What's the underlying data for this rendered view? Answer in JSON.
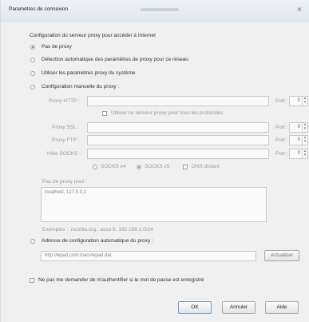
{
  "window": {
    "title": "Paramètres de connexion"
  },
  "section_heading": "Configuration du serveur proxy pour accéder à Internet",
  "proxy_options": {
    "no_proxy": "Pas de proxy",
    "auto_detect": "Détection automatique des paramètres de proxy pour ce réseau",
    "system": "Utiliser les paramètres proxy du système",
    "manual": "Configuration manuelle du proxy :",
    "auto_url": "Adresse de configuration automatique du proxy :"
  },
  "manual": {
    "http_label": "Proxy HTTP :",
    "use_for_all": "Utiliser ce serveur proxy pour tous les protocoles",
    "ssl_label": "Proxy SSL :",
    "ftp_label": "Proxy FTP :",
    "socks_label": "Hôte SOCKS :",
    "port_label": "Port :",
    "port_value": "0",
    "socks_v4": "SOCKS v4",
    "socks_v5": "SOCKS v5",
    "remote_dns": "DNS distant"
  },
  "no_proxy_for": {
    "label": "Pas de proxy pour :",
    "value": "localhost, 127.0.0.1",
    "example": "Exemples : .mozilla.org, .asso.fr, 192.168.1.0/24"
  },
  "auto_config": {
    "url": "http://wpad.cdm.mars/wpad.dat",
    "reload_label": "Actualiser"
  },
  "dont_prompt": "Ne pas me demander de m'authentifier si le mot de passe est enregistré",
  "buttons": {
    "ok": "OK",
    "cancel": "Annuler",
    "help": "Aide"
  }
}
